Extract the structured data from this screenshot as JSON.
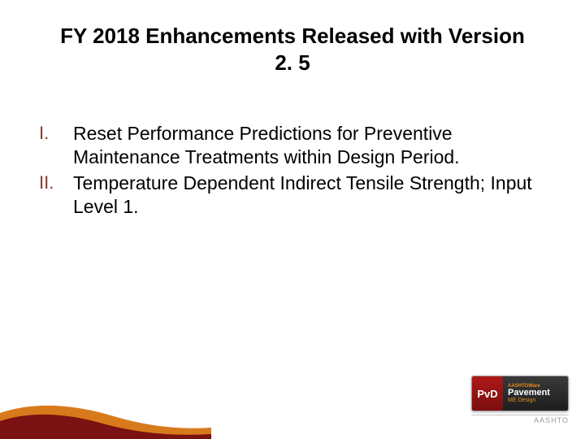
{
  "title": "FY 2018 Enhancements Released with Version 2. 5",
  "items": [
    {
      "marker": "I.",
      "text": "Reset Performance Predictions for Preventive Maintenance Treatments within Design Period."
    },
    {
      "marker": "II.",
      "text": "Temperature Dependent Indirect Tensile Strength; Input Level 1."
    }
  ],
  "brand": {
    "badge": "PvD",
    "tag": "AASHTOWare",
    "main": "Pavement",
    "sub": "ME Design",
    "foot": "AASHTO"
  },
  "colors": {
    "marker": "#8b3a2a",
    "swoosh_red": "#7a1212",
    "swoosh_orange": "#d87a1c"
  }
}
